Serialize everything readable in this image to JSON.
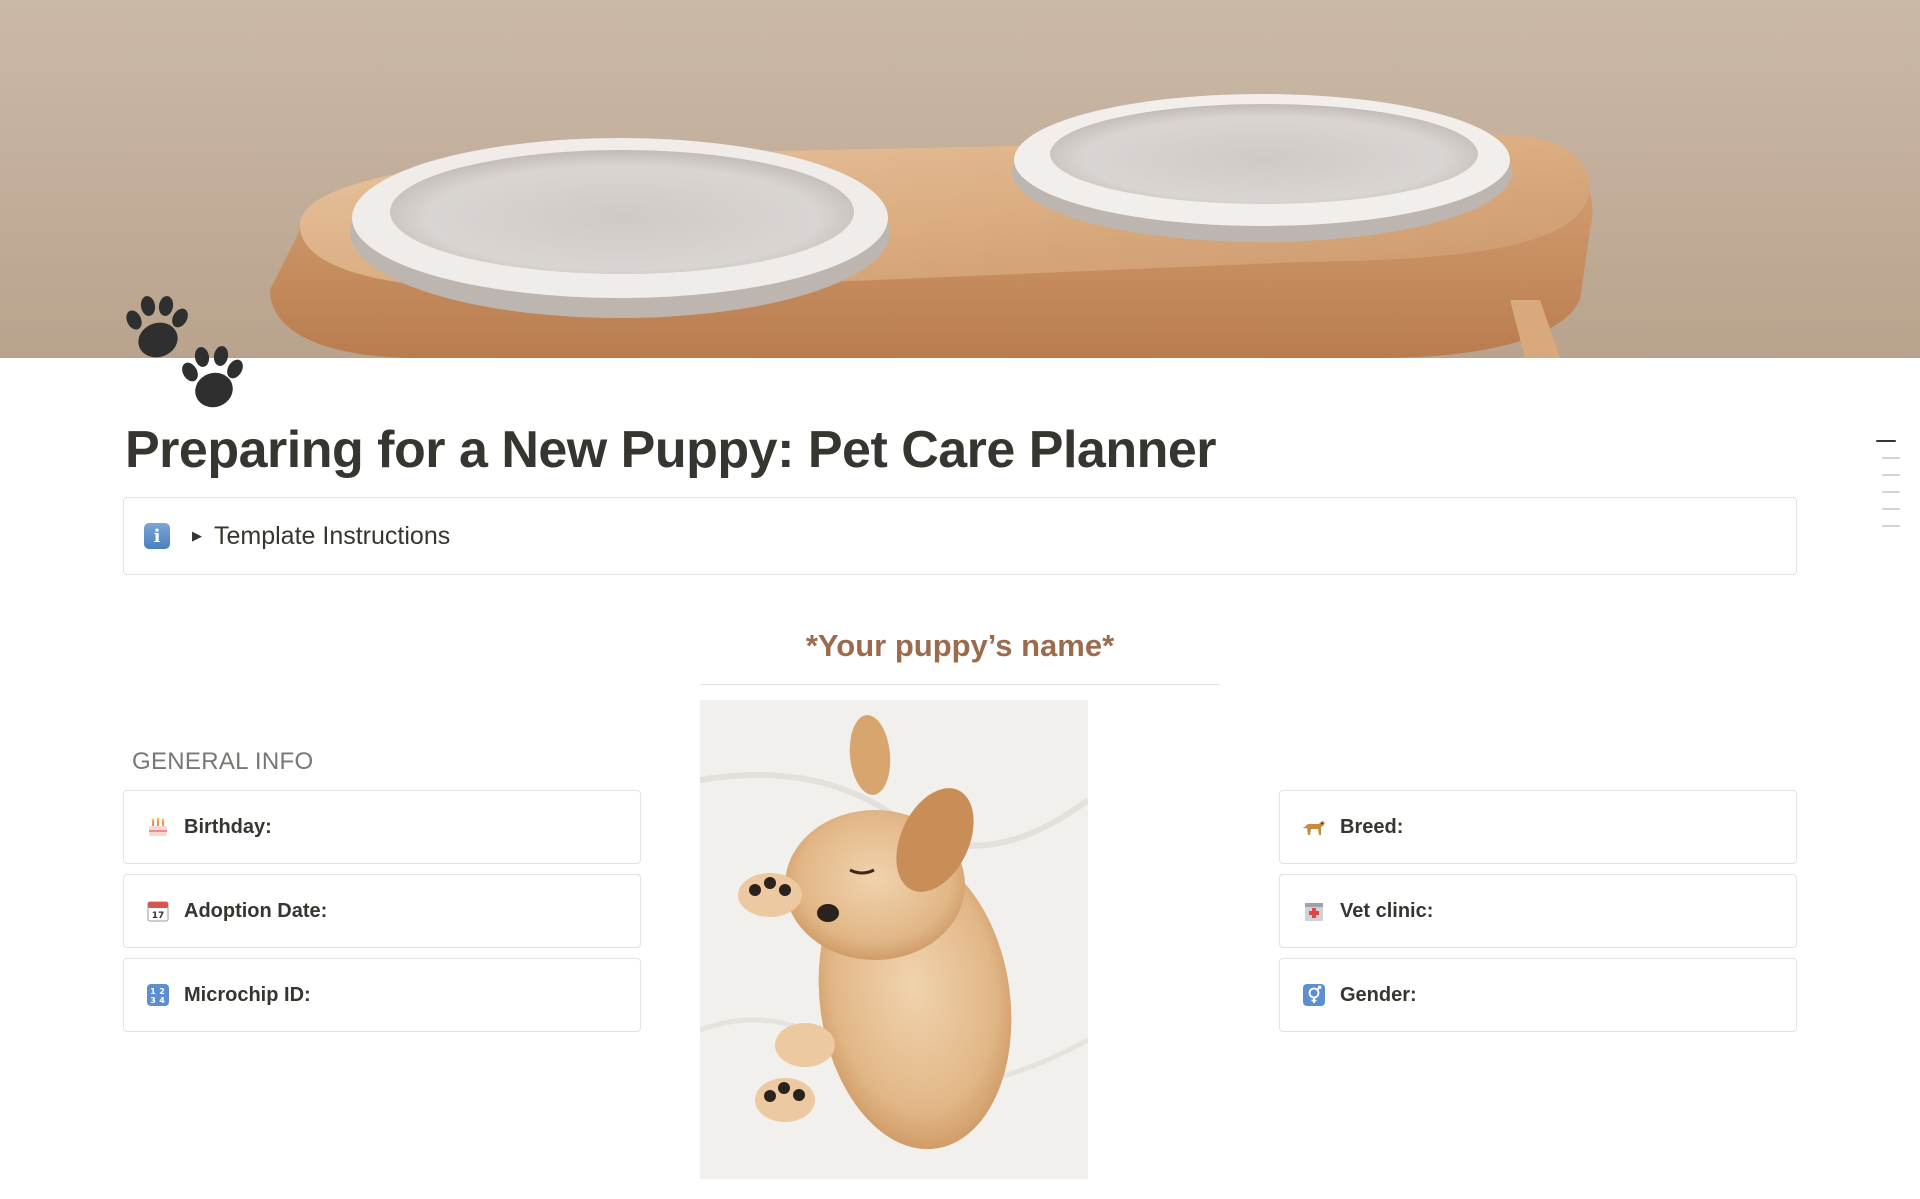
{
  "page": {
    "title": "Preparing for a New Puppy: Pet Care Planner",
    "icon": "paw-prints-icon",
    "cover": "cover-image-pet-bowls"
  },
  "callout": {
    "icon": "information-icon",
    "label": "Template Instructions"
  },
  "profile": {
    "name_heading": "*Your puppy’s name*",
    "photo": "puppy-photo"
  },
  "general_info": {
    "heading": "GENERAL INFO",
    "left_fields": [
      {
        "icon": "birthday-cake-icon",
        "label": "Birthday:"
      },
      {
        "icon": "calendar-icon",
        "label": "Adoption Date:"
      },
      {
        "icon": "number-input-icon",
        "label": "Microchip ID:"
      }
    ],
    "right_fields": [
      {
        "icon": "dog-icon",
        "label": "Breed:"
      },
      {
        "icon": "hospital-icon",
        "label": "Vet clinic:"
      },
      {
        "icon": "gender-symbol-icon",
        "label": "Gender:"
      }
    ]
  },
  "colors": {
    "text": "#37352f",
    "accent_brown": "#9c6b4e",
    "muted_heading": "#787774",
    "border": "#e3e2e0"
  }
}
